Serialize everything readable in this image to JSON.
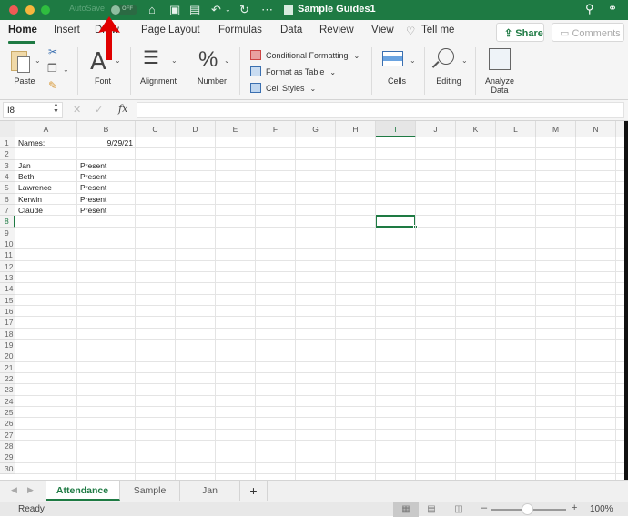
{
  "window": {
    "title": "Sample Guides1",
    "autosave_label": "AutoSave",
    "autosave_state": "OFF",
    "quick_access_icons": [
      "home-icon",
      "save-icon",
      "save-as-icon",
      "undo-icon",
      "redo-icon",
      "more-icon"
    ]
  },
  "tabs": {
    "items": [
      "Home",
      "Insert",
      "Draw",
      "Page Layout",
      "Formulas",
      "Data",
      "Review",
      "View"
    ],
    "active": "Home",
    "tell_me": "Tell me",
    "share": "Share",
    "comments": "Comments"
  },
  "ribbon": {
    "paste": "Paste",
    "font": "Font",
    "alignment": "Alignment",
    "number": "Number",
    "conditional_formatting": "Conditional Formatting",
    "format_as_table": "Format as Table",
    "cell_styles": "Cell Styles",
    "cells": "Cells",
    "editing": "Editing",
    "analyze_data": "Analyze Data"
  },
  "formula_bar": {
    "name_box": "I8",
    "formula": "",
    "fx": "fx"
  },
  "sheet": {
    "columns": [
      "A",
      "B",
      "C",
      "D",
      "E",
      "F",
      "G",
      "H",
      "I",
      "J",
      "K",
      "L",
      "M",
      "N"
    ],
    "rows": [
      "1",
      "2",
      "3",
      "4",
      "5",
      "6",
      "7",
      "8",
      "9",
      "10",
      "11",
      "12",
      "13",
      "14",
      "15",
      "16",
      "17",
      "18",
      "19",
      "20",
      "21",
      "22",
      "23",
      "24",
      "25",
      "26",
      "27",
      "28",
      "29",
      "30"
    ],
    "selected_cell": "I8",
    "cells": {
      "A1": "Names:",
      "B1": "9/29/21",
      "A3": "Jan",
      "B3": "Present",
      "A4": "Beth",
      "B4": "Present",
      "A5": "Lawrence",
      "B5": "Present",
      "A6": "Kerwin",
      "B6": "Present",
      "A7": "Claude",
      "B7": "Present"
    }
  },
  "sheet_tabs": {
    "items": [
      "Attendance",
      "Sample",
      "Jan"
    ],
    "active": "Attendance",
    "add": "+"
  },
  "status": {
    "text": "Ready",
    "zoom": "100%",
    "zoom_percent": 100
  },
  "annotation": {
    "color": "#e00000"
  }
}
